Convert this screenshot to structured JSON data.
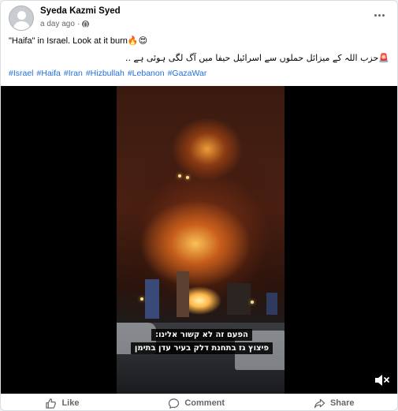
{
  "post": {
    "author": "Syeda Kazmi Syed",
    "timestamp": "a day ago",
    "privacy_icon": "globe-icon",
    "line1_text": "\"Haifa\" in Israel. Look at it burn",
    "line1_emojis": "🔥😍",
    "line2_text": "🚨حزب اللہ کے میزائل حملوں سے اسرائیل حیفا میں آگ لگی ہوئی ہے ..",
    "hashtags": [
      "#Israel",
      "#Haifa",
      "#Iran",
      "#Hizbullah",
      "#Lebanon",
      "#GazaWar"
    ]
  },
  "video": {
    "caption_line1": "הפעם זה לא קשור אלינו:",
    "caption_line2": "פיצוץ גז בתחנת דלק בעיר עדן בתימן",
    "mute_icon": "speaker-muted-icon"
  },
  "actions": {
    "like_label": "Like",
    "comment_label": "Comment",
    "share_label": "Share"
  },
  "colors": {
    "link": "#216fdb",
    "text_secondary": "#65676b"
  }
}
